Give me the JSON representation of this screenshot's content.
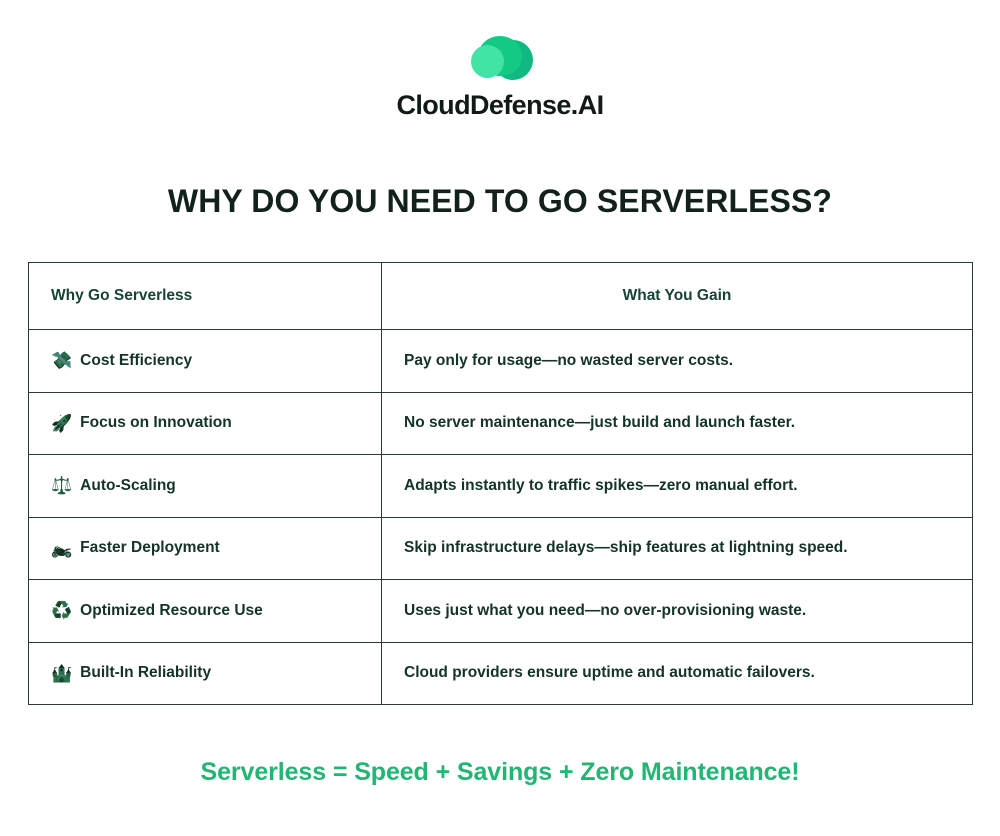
{
  "brand": {
    "name": "CloudDefense.AI",
    "logo_icon": "cloud-blobs-icon",
    "colors": {
      "blob_back": "#10b981",
      "blob_mid": "#14c984",
      "blob_front": "#42e3a4",
      "wordmark": "#111a17"
    }
  },
  "headline": "WHY DO YOU NEED TO GO SERVERLESS?",
  "table": {
    "columns": [
      {
        "label": "Why Go Serverless",
        "align": "left"
      },
      {
        "label": "What You Gain",
        "align": "center"
      }
    ],
    "rows": [
      {
        "emoji": "💸",
        "emoji_name": "money-with-wings-icon",
        "reason": "Cost Efficiency",
        "gain": "Pay only for usage—no wasted server costs."
      },
      {
        "emoji": "🚀",
        "emoji_name": "rocket-icon",
        "reason": "Focus on Innovation",
        "gain": "No server maintenance—just build and launch faster."
      },
      {
        "emoji": "⚖️",
        "emoji_name": "balance-scale-icon",
        "reason": "Auto-Scaling",
        "gain": "Adapts instantly to traffic spikes—zero manual effort."
      },
      {
        "emoji": "🏍️",
        "emoji_name": "motorcycle-icon",
        "reason": "Faster Deployment",
        "gain": "Skip infrastructure delays—ship features at lightning speed."
      },
      {
        "emoji": "♻️",
        "emoji_name": "recycling-icon",
        "reason": "Optimized Resource Use",
        "gain": "Uses just what you need—no over-provisioning waste."
      },
      {
        "emoji": "🏰",
        "emoji_name": "castle-icon",
        "reason": "Built-In Reliability",
        "gain": "Cloud providers ensure uptime and automatic failovers."
      }
    ]
  },
  "footer": {
    "tagline": "Serverless = Speed + Savings + Zero Maintenance!",
    "color": "#23b573"
  }
}
